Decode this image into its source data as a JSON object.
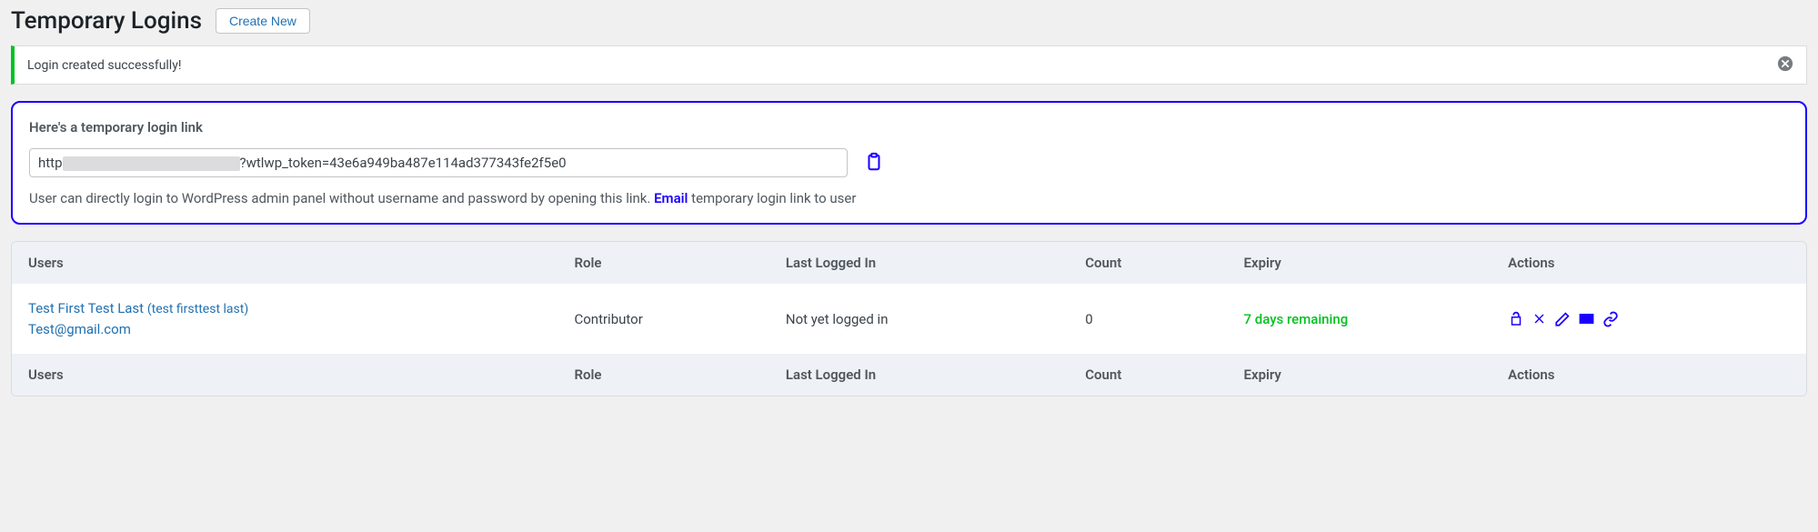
{
  "header": {
    "title": "Temporary Logins",
    "create_label": "Create New"
  },
  "notice": {
    "message": "Login created successfully!"
  },
  "linkbox": {
    "heading": "Here's a temporary login link",
    "url_prefix": "http",
    "url_suffix": "?wtlwp_token=43e6a949ba487e114ad377343fe2f5e0",
    "desc_before": "User can directly login to WordPress admin panel without username and password by opening this link. ",
    "email_label": "Email",
    "desc_after": " temporary login link to user"
  },
  "table": {
    "headers": {
      "users": "Users",
      "role": "Role",
      "last_login": "Last Logged In",
      "count": "Count",
      "expiry": "Expiry",
      "actions": "Actions"
    },
    "rows": [
      {
        "name": "Test First Test Last",
        "username": "(test firsttest last)",
        "email": "Test@gmail.com",
        "role": "Contributor",
        "last_login": "Not yet logged in",
        "count": "0",
        "expiry": "7 days remaining"
      }
    ]
  }
}
